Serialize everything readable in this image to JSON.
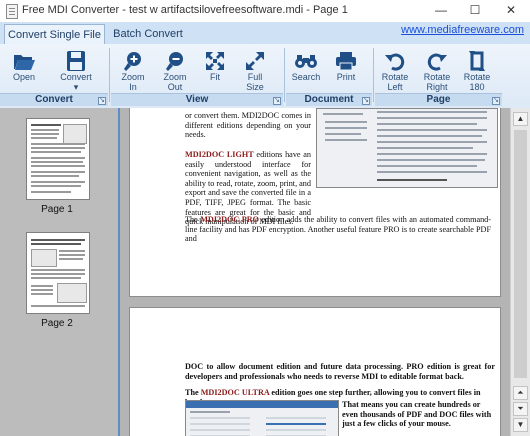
{
  "window": {
    "title": "Free MDI Converter - test w artifactsilovefreesoftware.mdi - Page 1",
    "minimize": "—",
    "maximize": "☐",
    "close": "✕"
  },
  "tabs": [
    {
      "label": "Convert Single File",
      "active": true
    },
    {
      "label": "Batch Convert",
      "active": false
    }
  ],
  "website": "www.mediafreeware.com",
  "ribbon": {
    "groups": [
      {
        "label": "Convert",
        "buttons": [
          {
            "label": "Open",
            "icon": "folder-open-icon"
          },
          {
            "label": "Convert\n▾",
            "icon": "save-disk-icon"
          }
        ]
      },
      {
        "label": "View",
        "buttons": [
          {
            "label": "Zoom\nIn",
            "icon": "zoom-in-icon"
          },
          {
            "label": "Zoom\nOut",
            "icon": "zoom-out-icon"
          },
          {
            "label": "Fit",
            "icon": "fit-icon"
          },
          {
            "label": "Full\nSize",
            "icon": "full-size-icon"
          }
        ]
      },
      {
        "label": "Document",
        "buttons": [
          {
            "label": "Search",
            "icon": "binoculars-icon"
          },
          {
            "label": "Print",
            "icon": "printer-icon"
          }
        ]
      },
      {
        "label": "Page",
        "buttons": [
          {
            "label": "Rotate\nLeft",
            "icon": "rotate-left-icon"
          },
          {
            "label": "Rotate\nRight",
            "icon": "rotate-right-icon"
          },
          {
            "label": "Rotate\n180",
            "icon": "rotate-180-icon"
          }
        ]
      }
    ]
  },
  "thumbnails": [
    {
      "label": "Page 1"
    },
    {
      "label": "Page 2"
    }
  ],
  "document": {
    "page1": {
      "para_a": "or convert them. MDI2DOC comes in different editions depending on your needs.",
      "para_b_brand": "MDI2DOC LIGHT",
      "para_b": " editions have an easily understood interface for convenient navigation, as well as the ability to read, rotate, zoom, print, and export and save the converted file in a PDF, TIFF, JPEG format. The basic features are great for the basic and quick manipulation of MDI files.",
      "para_c_pre": "The ",
      "para_c_brand": "MDI2DOC PRO",
      "para_c": " edition adds the ability to convert files with an automated command-line facility and has PDF encryption. Another useful feature PRO is to create searchable PDF and"
    },
    "page2": {
      "para_a": "DOC to allow document edition and future data processing. PRO edition is great for developers and professionals who needs to reverse MDI to editable format back.",
      "para_b_pre": "The ",
      "para_b_brand": "MDI2DOC ULTRA",
      "para_b": " edition goes one step further, allowing you to convert files in batches.",
      "para_c": "That means you can create hundreds or even thousands of PDF and DOC files with just a few clicks of your mouse."
    }
  },
  "scrollbar": {
    "up": "▲",
    "down_a": "⏶",
    "down_b": "⏷",
    "down_c": "▼"
  }
}
